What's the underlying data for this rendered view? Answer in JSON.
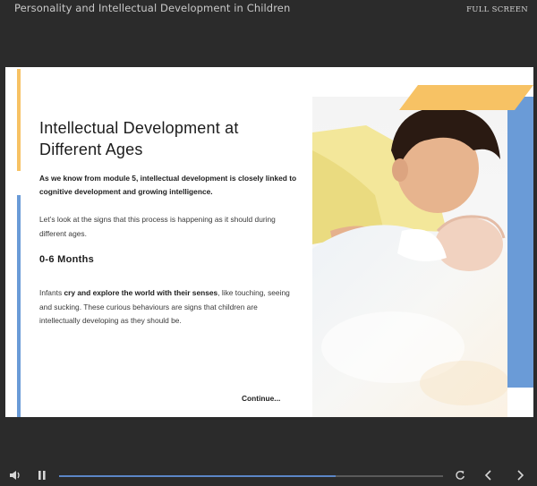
{
  "header": {
    "course_title": "Personality and Intellectual Development in Children",
    "fullscreen_label": "FULL SCREEN"
  },
  "slide": {
    "title": "Intellectual Development at Different Ages",
    "intro": "As we know from module 5, intellectual development is closely linked to cognitive development and growing intelligence.",
    "signs_text": "Let’s look at the signs that this process is happening as it should during different ages.",
    "subheading": "0-6 Months",
    "infants_lead": "Infants ",
    "infants_bold": "cry and explore the world with their senses",
    "infants_rest": ", like touching, seeing and sucking. These curious behaviours are signs that children are intellectually developing as they should be.",
    "continue_label": "Continue..."
  },
  "player": {
    "progress_fraction": 0.72
  },
  "icons": {
    "volume": "volume-icon",
    "pause": "pause-icon",
    "replay": "replay-icon",
    "prev": "chevron-left-icon",
    "next": "chevron-right-icon"
  },
  "colors": {
    "accent_yellow": "#f7c264",
    "accent_blue": "#6a9bd7",
    "progress": "#5b86c6",
    "background": "#2b2b2b"
  }
}
